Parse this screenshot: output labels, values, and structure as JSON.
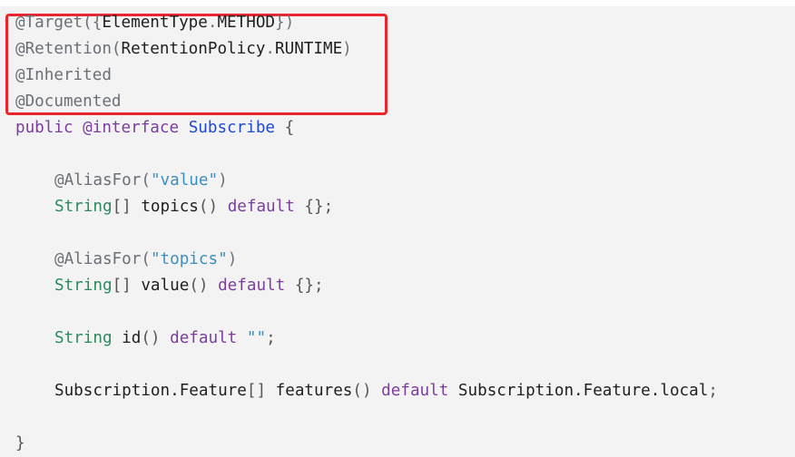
{
  "code": {
    "lines": [
      {
        "tokens": [
          {
            "t": "ann",
            "v": "@Target({"
          },
          {
            "t": "plain",
            "v": "ElementType"
          },
          {
            "t": "ann",
            "v": "."
          },
          {
            "t": "plain",
            "v": "METHOD"
          },
          {
            "t": "ann",
            "v": "})"
          }
        ]
      },
      {
        "tokens": [
          {
            "t": "ann",
            "v": "@Retention("
          },
          {
            "t": "plain",
            "v": "RetentionPolicy"
          },
          {
            "t": "ann",
            "v": "."
          },
          {
            "t": "plain",
            "v": "RUNTIME"
          },
          {
            "t": "ann",
            "v": ")"
          }
        ]
      },
      {
        "tokens": [
          {
            "t": "ann",
            "v": "@Inherited"
          }
        ]
      },
      {
        "tokens": [
          {
            "t": "ann",
            "v": "@Documented"
          }
        ]
      },
      {
        "tokens": [
          {
            "t": "kw",
            "v": "public "
          },
          {
            "t": "kw",
            "v": "@interface "
          },
          {
            "t": "name",
            "v": "Subscribe"
          },
          {
            "t": "punc",
            "v": " {"
          }
        ]
      },
      {
        "tokens": []
      },
      {
        "indent": 1,
        "tokens": [
          {
            "t": "ann",
            "v": "@AliasFor("
          },
          {
            "t": "str",
            "v": "\"value\""
          },
          {
            "t": "ann",
            "v": ")"
          }
        ]
      },
      {
        "indent": 1,
        "tokens": [
          {
            "t": "type",
            "v": "String"
          },
          {
            "t": "punc",
            "v": "[] "
          },
          {
            "t": "plain",
            "v": "topics"
          },
          {
            "t": "punc",
            "v": "() "
          },
          {
            "t": "kw",
            "v": "default"
          },
          {
            "t": "punc",
            "v": " {};"
          }
        ]
      },
      {
        "tokens": []
      },
      {
        "indent": 1,
        "tokens": [
          {
            "t": "ann",
            "v": "@AliasFor("
          },
          {
            "t": "str",
            "v": "\"topics\""
          },
          {
            "t": "ann",
            "v": ")"
          }
        ]
      },
      {
        "indent": 1,
        "tokens": [
          {
            "t": "type",
            "v": "String"
          },
          {
            "t": "punc",
            "v": "[] "
          },
          {
            "t": "plain",
            "v": "value"
          },
          {
            "t": "punc",
            "v": "() "
          },
          {
            "t": "kw",
            "v": "default"
          },
          {
            "t": "punc",
            "v": " {};"
          }
        ]
      },
      {
        "tokens": []
      },
      {
        "indent": 1,
        "tokens": [
          {
            "t": "type",
            "v": "String "
          },
          {
            "t": "plain",
            "v": "id"
          },
          {
            "t": "punc",
            "v": "() "
          },
          {
            "t": "kw",
            "v": "default "
          },
          {
            "t": "str",
            "v": "\"\""
          },
          {
            "t": "punc",
            "v": ";"
          }
        ]
      },
      {
        "tokens": []
      },
      {
        "indent": 1,
        "tokens": [
          {
            "t": "plain",
            "v": "Subscription.Feature"
          },
          {
            "t": "punc",
            "v": "[] "
          },
          {
            "t": "plain",
            "v": "features"
          },
          {
            "t": "punc",
            "v": "() "
          },
          {
            "t": "kw",
            "v": "default "
          },
          {
            "t": "plain",
            "v": "Subscription.Feature.local"
          },
          {
            "t": "punc",
            "v": ";"
          }
        ]
      },
      {
        "tokens": []
      },
      {
        "tokens": [
          {
            "t": "punc",
            "v": "}"
          }
        ]
      }
    ]
  },
  "colors": {
    "background": "#f3f3f3",
    "highlight_border": "#e8262b"
  }
}
